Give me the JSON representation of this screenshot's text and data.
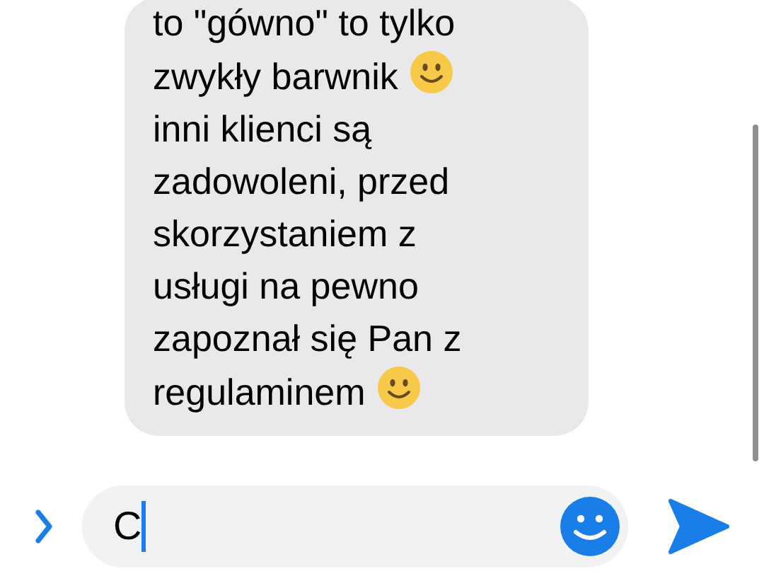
{
  "message": {
    "lines": [
      {
        "text": "to \"gówno\" to tylko",
        "emoji": false
      },
      {
        "text": "zwykły barwnik",
        "emoji": true
      },
      {
        "text": "inni klienci są",
        "emoji": false
      },
      {
        "text": "zadowoleni, przed",
        "emoji": false
      },
      {
        "text": "skorzystaniem z",
        "emoji": false
      },
      {
        "text": "usługi na pewno",
        "emoji": false
      },
      {
        "text": "zapoznał się Pan z",
        "emoji": false
      },
      {
        "text": "regulaminem",
        "emoji": true
      }
    ]
  },
  "composer": {
    "value": "C"
  }
}
